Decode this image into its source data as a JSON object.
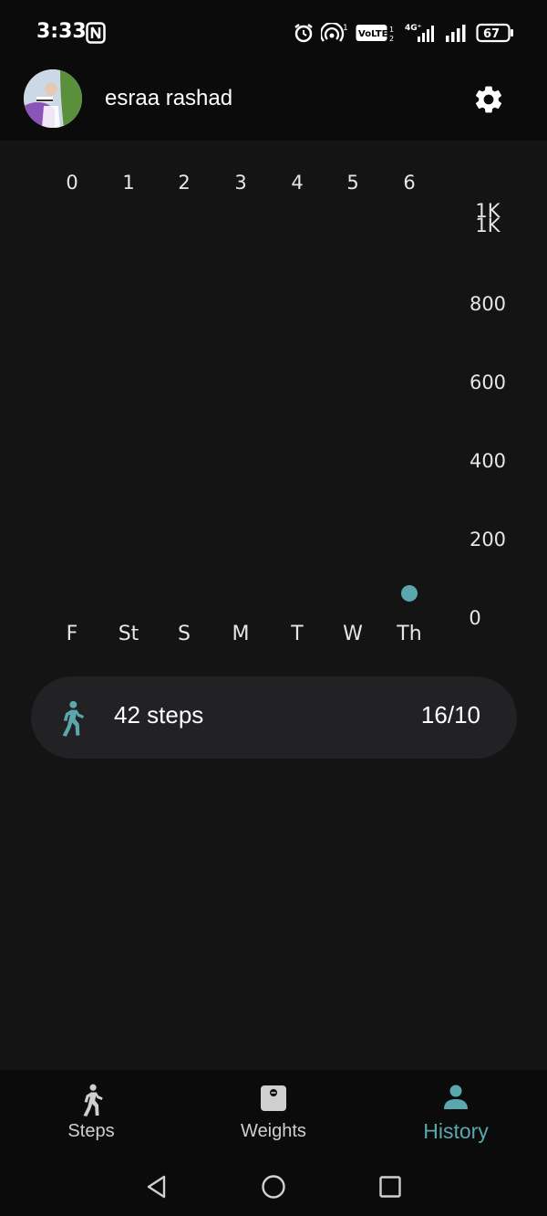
{
  "status_bar": {
    "time": "3:33",
    "network": "4G⁺",
    "battery": "67",
    "volte": "VoLTE",
    "icons": [
      "nfc-icon",
      "alarm-icon",
      "hotspot-icon",
      "volte-icon",
      "signal-icon",
      "battery-icon"
    ]
  },
  "header": {
    "user_name": "esraa rashad",
    "settings_icon": "gear-icon"
  },
  "chart_data": {
    "type": "scatter",
    "x_top_ticks": [
      "0",
      "1",
      "2",
      "3",
      "4",
      "5",
      "6"
    ],
    "categories": [
      "F",
      "St",
      "S",
      "M",
      "T",
      "W",
      "Th"
    ],
    "y_ticks": [
      "0",
      "200",
      "400",
      "600",
      "800",
      "1K",
      "1K"
    ],
    "ylim": [
      0,
      1000
    ],
    "series": [
      {
        "values": [
          null,
          null,
          null,
          null,
          null,
          null,
          42
        ]
      }
    ],
    "point_color": "#5aa7ad"
  },
  "summary": {
    "steps_label": "42 steps",
    "date_label": "16/10"
  },
  "bottom_nav": {
    "items": [
      {
        "label": "Steps",
        "icon": "walk-icon"
      },
      {
        "label": "Weights",
        "icon": "scale-icon"
      },
      {
        "label": "History",
        "icon": "person-icon"
      }
    ],
    "active": "History",
    "accent": "#5aa7ad"
  },
  "system_nav": [
    "back-icon",
    "home-icon",
    "recents-icon"
  ]
}
